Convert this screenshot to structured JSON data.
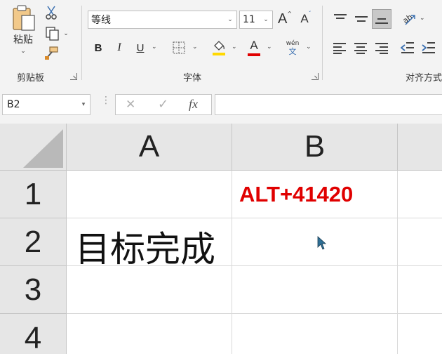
{
  "ribbon": {
    "clipboard": {
      "paste_label": "粘贴",
      "group_label": "剪贴板"
    },
    "font": {
      "font_name": "等线",
      "font_size": "11",
      "bold": "B",
      "italic": "I",
      "underline": "U",
      "font_color_glyph": "A",
      "pinyin_top": "wén",
      "pinyin_bottom": "文",
      "group_label": "字体",
      "grow_glyph": "A",
      "shrink_glyph": "A"
    },
    "alignment": {
      "group_label": "对齐方式"
    },
    "colors": {
      "fill_bar": "#ffd800",
      "font_color_bar": "#e00000"
    }
  },
  "formula_bar": {
    "name_box": "B2",
    "cancel_glyph": "✕",
    "enter_glyph": "✓",
    "fx_glyph": "fx",
    "content": ""
  },
  "sheet": {
    "columns": [
      "A",
      "B"
    ],
    "rows": [
      "1",
      "2",
      "3",
      "4"
    ],
    "cells": {
      "B1": "ALT+41420",
      "A2": "目标完成"
    },
    "b1_color": "#e00000"
  }
}
